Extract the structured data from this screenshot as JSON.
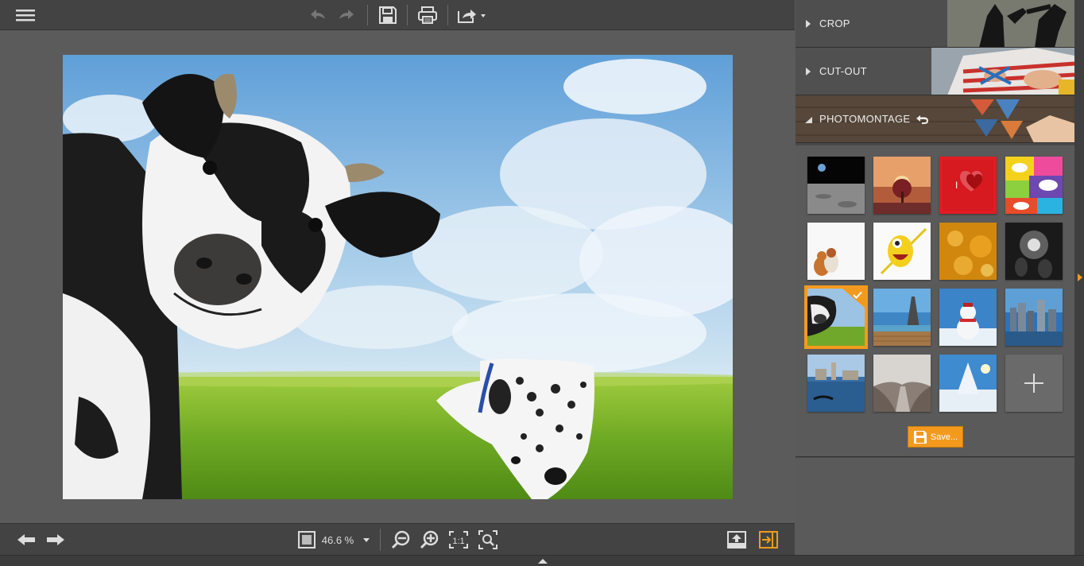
{
  "toolbar": {
    "icons": [
      "menu-icon",
      "undo-icon",
      "redo-icon",
      "save-icon",
      "print-icon",
      "share-icon"
    ]
  },
  "bottombar": {
    "zoom_value": "46.6 %",
    "icons": [
      "previous-image-icon",
      "next-image-icon",
      "fit-window-icon",
      "zoom-dropdown-icon",
      "zoom-out-icon",
      "zoom-in-icon",
      "actual-size-icon",
      "zoom-fit-icon",
      "export-icon",
      "toggle-panel-icon"
    ]
  },
  "panel": {
    "sections": [
      {
        "label": "CROP",
        "expanded": false
      },
      {
        "label": "CUT-OUT",
        "expanded": false
      },
      {
        "label": "PHOTOMONTAGE",
        "expanded": true
      }
    ],
    "save_label": "Save...",
    "templates": [
      "moon",
      "sunset-tree",
      "heart",
      "comic",
      "pets",
      "yellow-monster",
      "gold-bokeh",
      "spotlight",
      "cow-field",
      "eiffel",
      "snowman",
      "city",
      "venice",
      "winter-path",
      "snow-tree",
      "add"
    ]
  },
  "colors": {
    "accent": "#f39a1e",
    "toolbar": "#434343",
    "canvas": "#5b5b5b"
  }
}
